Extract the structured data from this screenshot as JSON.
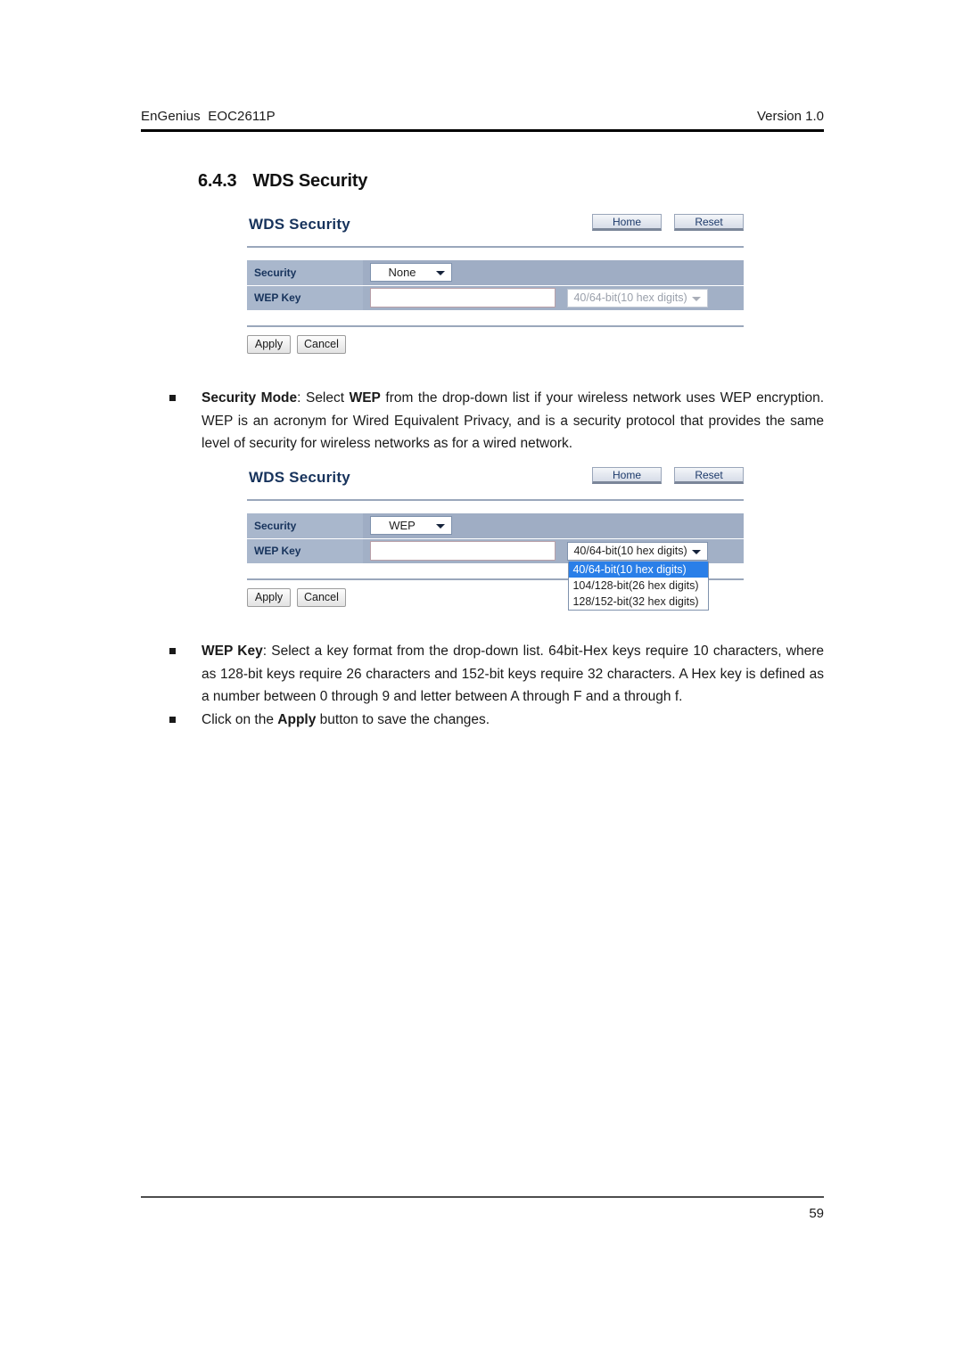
{
  "document": {
    "header": {
      "left": "EnGenius  EOC2611P",
      "right": "Version 1.0"
    },
    "section": {
      "number": "6.4.3",
      "title": "WDS Security"
    },
    "footer": {
      "page_number": "59"
    }
  },
  "panel_none": {
    "title": "WDS Security",
    "nav": {
      "home_label": "Home",
      "reset_label": "Reset"
    },
    "rows": {
      "security_label": "Security",
      "security_value": "None",
      "wep_key_label": "WEP Key",
      "wep_key_value": "",
      "wep_key_placeholder": "",
      "key_format_value": "40/64-bit(10 hex digits)"
    },
    "actions": {
      "apply_label": "Apply",
      "cancel_label": "Cancel"
    }
  },
  "panel_wep": {
    "title": "WDS Security",
    "nav": {
      "home_label": "Home",
      "reset_label": "Reset"
    },
    "rows": {
      "security_label": "Security",
      "security_value": "WEP",
      "wep_key_label": "WEP Key",
      "wep_key_value": "",
      "wep_key_placeholder": "",
      "key_format_value": "40/64-bit(10 hex digits)"
    },
    "key_format_options": [
      "40/64-bit(10 hex digits)",
      "104/128-bit(26 hex digits)",
      "128/152-bit(32 hex digits)"
    ],
    "key_format_selected_index": 0,
    "actions": {
      "apply_label": "Apply",
      "cancel_label": "Cancel"
    }
  },
  "bullets_after_first_panel": [
    {
      "html": "<b>Security Mode</b>: Select <b>WEP</b> from the drop-down list if your wireless network uses WEP encryption. WEP is an acronym for Wired Equivalent Privacy, and is a security protocol that provides the same level of security for wireless networks as for a wired network."
    }
  ],
  "bullets_after_second_panel": [
    {
      "html": "<b>WEP Key</b>: Select a key format from the drop-down list. 64bit-Hex keys require 10 characters, where as 128-bit keys require 26 characters and 152-bit keys require 32 characters. A Hex key is defined as a number between 0 through 9 and letter between A through F and a through f."
    },
    {
      "html": "Click on the <b>Apply</b> button to save the changes."
    }
  ],
  "colors": {
    "panel_title": "#17335c",
    "label_cell_bg": "#a9b7cc",
    "value_cell_bg": "#9fadc4",
    "dropdown_highlight": "#2a7fe8",
    "rule": "#9aa7bb"
  }
}
